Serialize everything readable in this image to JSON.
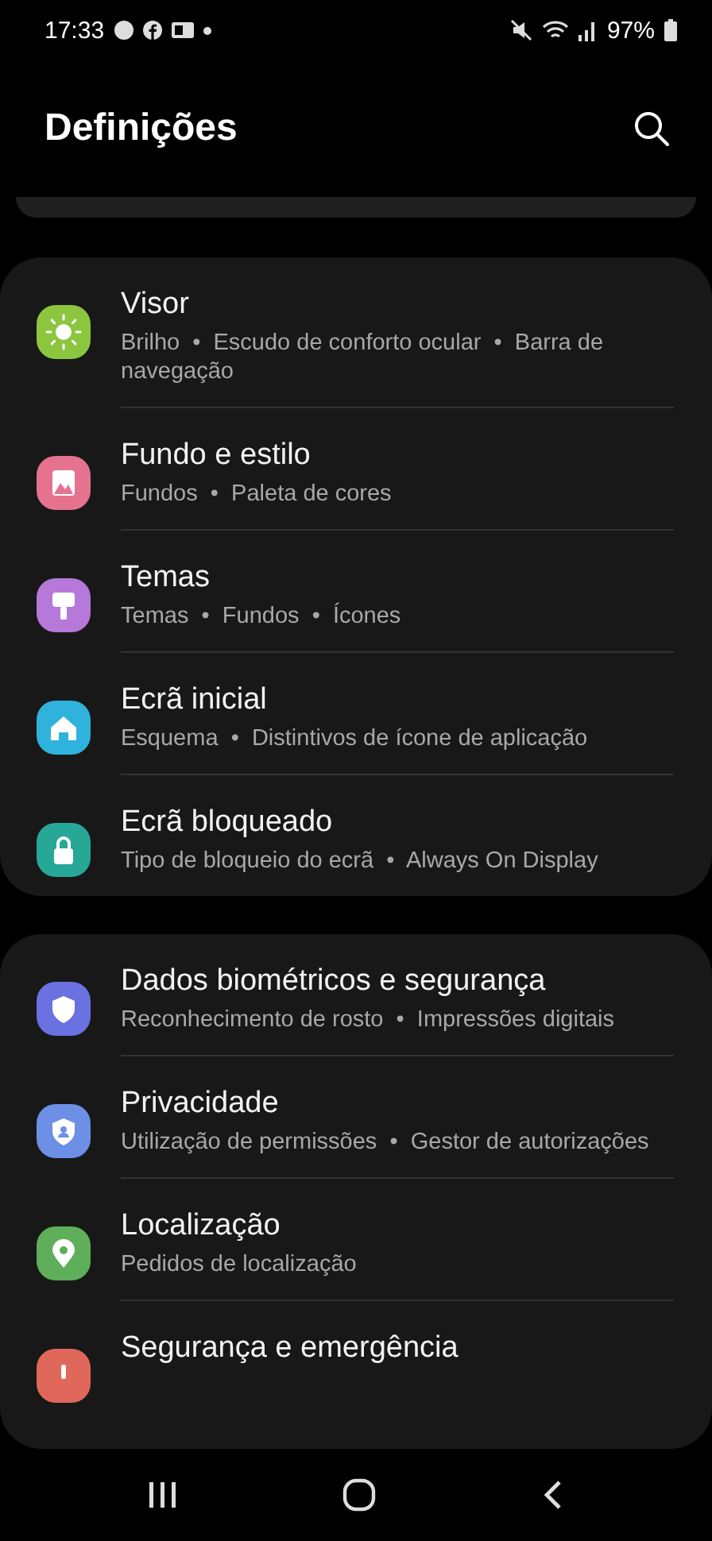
{
  "status_bar": {
    "time": "17:33",
    "battery": "97%"
  },
  "header": {
    "title": "Definições"
  },
  "groups": [
    {
      "items": [
        {
          "kind": "display",
          "color": "#8cc63f",
          "title": "Visor",
          "subtitle": "Brilho  •  Escudo de conforto ocular  •  Barra de navegação"
        },
        {
          "kind": "wallpaper",
          "color": "#e5728f",
          "title": "Fundo e estilo",
          "subtitle": "Fundos  •  Paleta de cores"
        },
        {
          "kind": "themes",
          "color": "#b678d9",
          "title": "Temas",
          "subtitle": "Temas  •  Fundos  •  Ícones"
        },
        {
          "kind": "home",
          "color": "#2fb3dc",
          "title": "Ecrã inicial",
          "subtitle": "Esquema  •  Distintivos de ícone de aplicação"
        },
        {
          "kind": "lock",
          "color": "#27a897",
          "title": "Ecrã bloqueado",
          "subtitle": "Tipo de bloqueio do ecrã  •  Always On Display"
        }
      ]
    },
    {
      "items": [
        {
          "kind": "shield",
          "color": "#6a71e0",
          "title": "Dados biométricos e segurança",
          "subtitle": "Reconhecimento de rosto  •  Impressões digitais"
        },
        {
          "kind": "privacy",
          "color": "#6d8fe6",
          "title": "Privacidade",
          "subtitle": "Utilização de permissões  •  Gestor de autorizações"
        },
        {
          "kind": "location",
          "color": "#5eae5a",
          "title": "Localização",
          "subtitle": "Pedidos de localização"
        },
        {
          "kind": "alert",
          "color": "#e0685a",
          "title": "Segurança e emergência"
        }
      ]
    }
  ]
}
